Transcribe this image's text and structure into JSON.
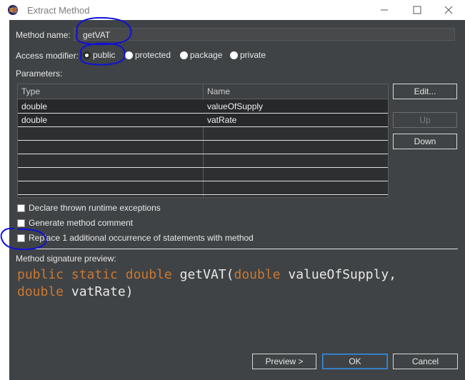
{
  "window": {
    "title": "Extract Method",
    "colors": {
      "annotation": "#1010d8",
      "keyword": "#cc7832",
      "default_border": "#3d8ee0"
    }
  },
  "method_name": {
    "label": "Method name:",
    "value": "getVAT"
  },
  "access_modifier": {
    "label": "Access modifier:",
    "options": [
      "public",
      "protected",
      "package",
      "private"
    ],
    "selected": "public"
  },
  "parameters": {
    "label": "Parameters:",
    "columns": [
      "Type",
      "Name"
    ],
    "rows": [
      {
        "type": "double",
        "name": "valueOfSupply"
      },
      {
        "type": "double",
        "name": "vatRate"
      }
    ]
  },
  "param_buttons": {
    "edit": "Edit...",
    "up": "Up",
    "down": "Down"
  },
  "options": {
    "declare_exceptions": "Declare thrown runtime exceptions",
    "generate_comment": "Generate method comment",
    "replace_occurrences": "Replace 1 additional occurrence of statements with method"
  },
  "signature": {
    "label": "Method signature preview:",
    "tokens": {
      "public": "public",
      "static": "static",
      "return_type": "double",
      "name": "getVAT(",
      "p1_type": "double",
      "p1_name": "valueOfSupply,",
      "p2_type": "double",
      "p2_name": "vatRate)"
    }
  },
  "footer": {
    "preview": "Preview >",
    "ok": "OK",
    "cancel": "Cancel"
  },
  "icons": {
    "app": "eclipse-icon",
    "minimize": "minimize-icon",
    "maximize": "maximize-icon",
    "close": "close-icon"
  }
}
